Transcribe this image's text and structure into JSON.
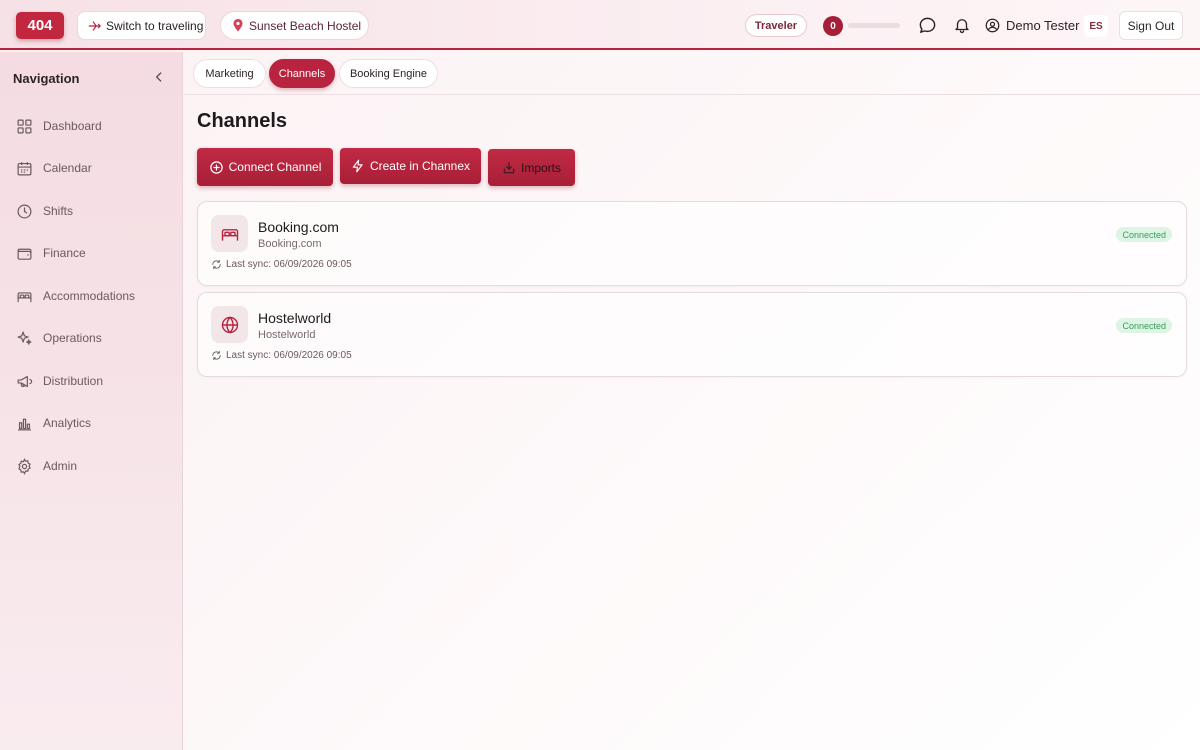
{
  "header": {
    "logo_text": "404",
    "switch_label": "Switch to traveling",
    "hostel_label": "Sunset Beach Hostel",
    "role_badge": "Traveler",
    "counter_value": "0",
    "progress_fraction": 0,
    "user_name": "Demo Tester",
    "language": "ES",
    "signout_label": "Sign Out"
  },
  "sidebar": {
    "heading": "Navigation",
    "items": [
      {
        "label": "Dashboard",
        "icon": "grid-icon"
      },
      {
        "label": "Calendar",
        "icon": "calendar-icon"
      },
      {
        "label": "Shifts",
        "icon": "clock-icon"
      },
      {
        "label": "Finance",
        "icon": "wallet-icon"
      },
      {
        "label": "Accommodations",
        "icon": "bed-icon"
      },
      {
        "label": "Operations",
        "icon": "sparkle-icon"
      },
      {
        "label": "Distribution",
        "icon": "megaphone-icon"
      },
      {
        "label": "Analytics",
        "icon": "bar-chart-icon"
      },
      {
        "label": "Admin",
        "icon": "gear-icon"
      }
    ]
  },
  "tabs": [
    {
      "label": "Marketing",
      "active": false
    },
    {
      "label": "Channels",
      "active": true
    },
    {
      "label": "Booking Engine",
      "active": false
    }
  ],
  "main": {
    "title": "Channels",
    "actions": {
      "connect": "Connect Channel",
      "create": "Create in Channex",
      "imports": "Imports"
    },
    "channels": [
      {
        "name": "Booking.com",
        "subtitle": "Booking.com",
        "last_sync": "Last sync: 06/09/2026 09:05",
        "status": "Connected",
        "icon": "bed-icon"
      },
      {
        "name": "Hostelworld",
        "subtitle": "Hostelworld",
        "last_sync": "Last sync: 06/09/2026 09:05",
        "status": "Connected",
        "icon": "globe-icon"
      }
    ]
  },
  "colors": {
    "accent": "#b8243f",
    "status_green": "#3a9c5c",
    "status_green_bg": "#def5e6"
  }
}
